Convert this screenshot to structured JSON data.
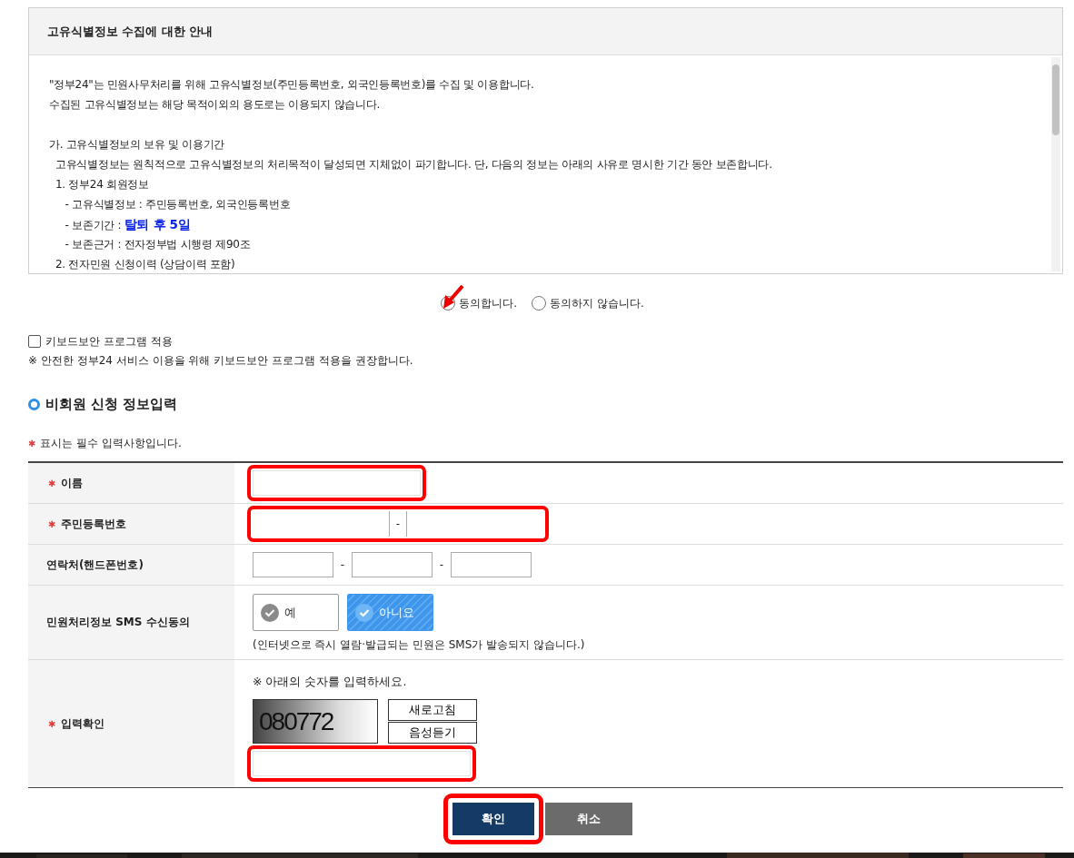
{
  "notice": {
    "title": "고유식별정보 수집에 대한 안내",
    "lines": [
      {
        "kind": "text",
        "text": "\"정부24\"는 민원사무처리를 위해 고유식별정보(주민등록번호, 외국인등록번호)를 수집 및 이용합니다."
      },
      {
        "kind": "text",
        "text": "수집된 고유식별정보는 해당 목적이외의 용도로는 이용되지 않습니다."
      },
      {
        "kind": "blank"
      },
      {
        "kind": "text",
        "text": "가. 고유식별정보의 보유 및 이용기간"
      },
      {
        "kind": "text",
        "text": "  고유식별정보는 원칙적으로 고유식별정보의 처리목적이 달성되면 지체없이 파기합니다. 단, 다음의 정보는 아래의 사유로 명시한 기간 동안 보존합니다."
      },
      {
        "kind": "text",
        "text": "  1. 정부24 회원정보"
      },
      {
        "kind": "text",
        "text": "     - 고유식별정보 : 주민등록번호, 외국인등록번호"
      },
      {
        "kind": "text",
        "text": "     - 보존기간 : **탈퇴 후 5일**"
      },
      {
        "kind": "text",
        "text": "     - 보존근거 : 전자정부법 시행령 제90조"
      },
      {
        "kind": "text",
        "text": "  2. 전자민원 신청이력 (상담이력 포함)"
      }
    ]
  },
  "consent": [
    {
      "label": "동의합니다.",
      "selected": false,
      "pointer": true
    },
    {
      "label": "동의하지 않습니다.",
      "selected": false,
      "pointer": false
    }
  ],
  "keyboard_security": {
    "label": "키보드보안 프로그램 적용",
    "checked": false,
    "note": "※ 안전한 정부24 서비스 이용을 위해 키보드보안 프로그램 적용을 권장합니다."
  },
  "section_title": "비회원 신청 정보입력",
  "required_symbol": "✱",
  "required_note": "표시는 필수 입력사항입니다.",
  "form_rows": [
    {
      "kind": "name",
      "label": "이름",
      "required": true,
      "highlighted": true
    },
    {
      "kind": "rrn",
      "label": "주민등록번호",
      "required": true,
      "highlighted": true,
      "separator": "-"
    },
    {
      "kind": "phone",
      "label": "연락처(핸드폰번호)",
      "required": false,
      "highlighted": false,
      "separators": [
        "-",
        "-"
      ]
    },
    {
      "kind": "sms",
      "label": "민원처리정보 SMS 수신동의",
      "required": false,
      "options": [
        {
          "label": "예",
          "selected": false
        },
        {
          "label": "아니요",
          "selected": true
        }
      ],
      "note": "(인터넷으로 즉시 열람·발급되는 민원은 SMS가 발송되지 않습니다.)"
    },
    {
      "kind": "captcha",
      "label": "입력확인",
      "required": true,
      "highlighted": true,
      "instruction": "※ 아래의 숫자를 입력하세요.",
      "code": "080772",
      "buttons": [
        "새로고침",
        "음성듣기"
      ]
    }
  ],
  "buttons": [
    {
      "label": "확인",
      "kind": "primary",
      "highlighted": true
    },
    {
      "label": "취소",
      "kind": "secondary",
      "highlighted": false
    }
  ]
}
